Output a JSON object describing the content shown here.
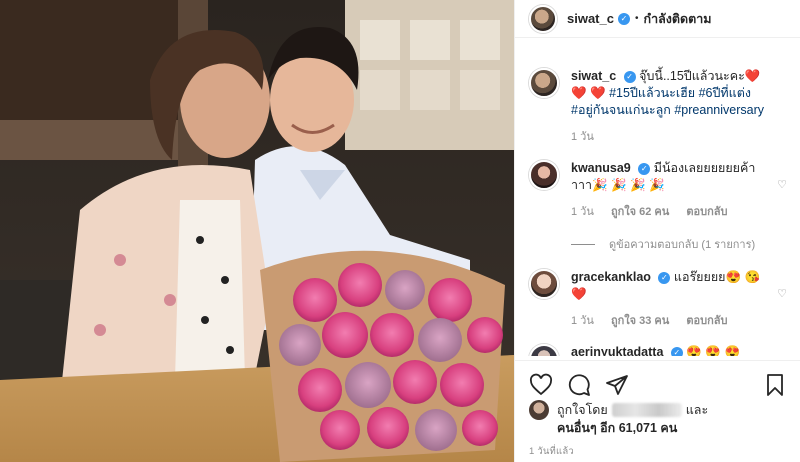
{
  "post": {
    "username": "siwat_c",
    "follow_status": "กำลังติดตาม",
    "caption": {
      "text": "จุ๊บนี้..15ปีแล้วนะคะ",
      "emojis": "❤️ ❤️ ❤️",
      "hashtags": "#15ปีแล้วนะเฮีย #6ปีที่แต่ง #อยู่กันจนแก่นะลูก #preanniversary",
      "time": "1 วัน"
    }
  },
  "comments": [
    {
      "username": "kwanusa9",
      "text": "มีน้องเลยยยยยยค้าาาา",
      "emojis": "🎉 🎉 🎉 🎉",
      "time": "1 วัน",
      "likes": "ถูกใจ 62 คน",
      "reply": "ตอบกลับ",
      "view_replies": "ดูข้อความตอบกลับ (1 รายการ)"
    },
    {
      "username": "gracekanklao",
      "text": "แอร๊ยยยย",
      "emojis": "😍 😘 ❤️",
      "time": "1 วัน",
      "likes": "ถูกใจ 33 คน",
      "reply": "ตอบกลับ"
    },
    {
      "username": "aerinyuktadatta",
      "text": "",
      "emojis": "😍 😍 😍"
    }
  ],
  "likes_section": {
    "liked_by_prefix": "ถูกใจโดย",
    "and": "และ",
    "others": "คนอื่นๆ อีก 61,071 คน"
  },
  "posted_time": "1 วันที่แล้ว",
  "icons": [
    "heart-icon",
    "comment-icon",
    "share-icon",
    "bookmark-icon",
    "verified-badge-icon",
    "small-heart-icon"
  ],
  "colors": {
    "hashtag": "#00376b",
    "verified": "#3897f0",
    "muted": "#8e8e8e",
    "text": "#262626"
  }
}
